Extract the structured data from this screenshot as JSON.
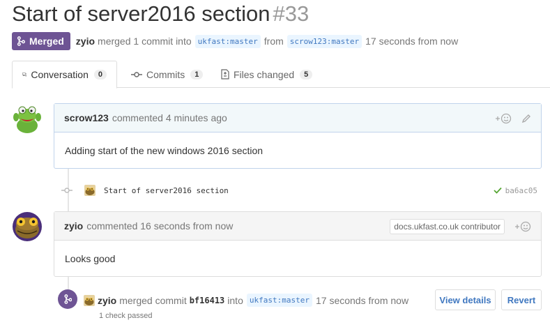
{
  "pr": {
    "title": "Start of server2016 section",
    "number": "#33",
    "state": "Merged",
    "author": "zyio",
    "merge_summary": "merged 1 commit into",
    "base_org": "ukfast",
    "base_branch": "master",
    "from_word": "from",
    "head_org": "scrow123",
    "head_branch": "master",
    "time": "17 seconds from now",
    "branch_sep": ":"
  },
  "tabs": [
    {
      "label": "Conversation",
      "count": "0",
      "icon": "comment-discussion-icon"
    },
    {
      "label": "Commits",
      "count": "1",
      "icon": "git-commit-icon"
    },
    {
      "label": "Files changed",
      "count": "5",
      "icon": "diff-icon"
    }
  ],
  "comments": [
    {
      "author": "scrow123",
      "action": "commented 4 minutes ago",
      "body": "Adding start of the new windows 2016 section"
    },
    {
      "author": "zyio",
      "action": "commented 16 seconds from now",
      "role_label": "docs.ukfast.co.uk contributor",
      "body": "Looks good"
    }
  ],
  "commit": {
    "message": "Start of server2016 section",
    "sha": "ba6ac05",
    "status_icon": "check-icon"
  },
  "merge_event": {
    "author": "zyio",
    "verb": "merged commit",
    "sha": "bf16413",
    "into": "into",
    "org": "ukfast",
    "branch": "master",
    "time": "17 seconds from now",
    "checks": "1 check passed",
    "view_details_label": "View details",
    "revert_label": "Revert"
  },
  "colors": {
    "merged": "#6e5494",
    "link": "#4078c0",
    "success": "#55a532"
  }
}
